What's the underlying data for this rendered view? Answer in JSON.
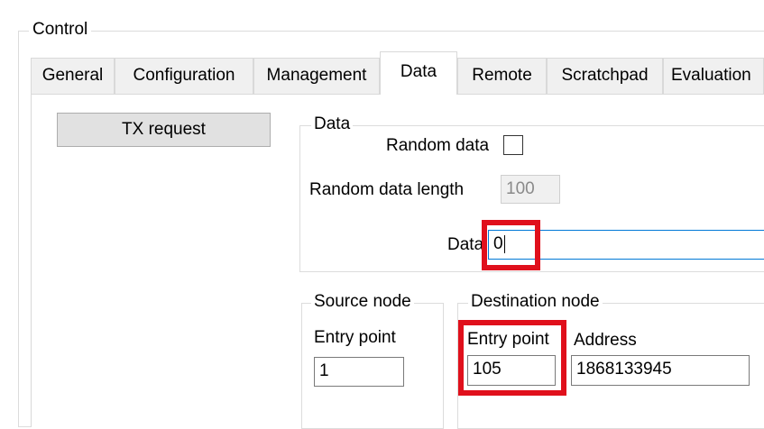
{
  "control": {
    "title": "Control"
  },
  "tabs": [
    {
      "label": "General"
    },
    {
      "label": "Configuration"
    },
    {
      "label": "Management"
    },
    {
      "label": "Data",
      "active": true
    },
    {
      "label": "Remote"
    },
    {
      "label": "Scratchpad"
    },
    {
      "label": "Evaluation"
    }
  ],
  "tx_button": {
    "label": "TX request"
  },
  "data_group": {
    "title": "Data",
    "random_data_label": "Random data",
    "random_data_checked": false,
    "random_length_label": "Random data length",
    "random_length_value": "100",
    "data_label": "Data",
    "data_value": "0"
  },
  "source_node": {
    "title": "Source node",
    "entry_point_label": "Entry point",
    "entry_point_value": "1"
  },
  "destination_node": {
    "title": "Destination node",
    "entry_point_label": "Entry point",
    "entry_point_value": "105",
    "address_label": "Address",
    "address_value": "1868133945"
  },
  "colors": {
    "highlight": "#e0101c",
    "focus_border": "#0078d7"
  }
}
